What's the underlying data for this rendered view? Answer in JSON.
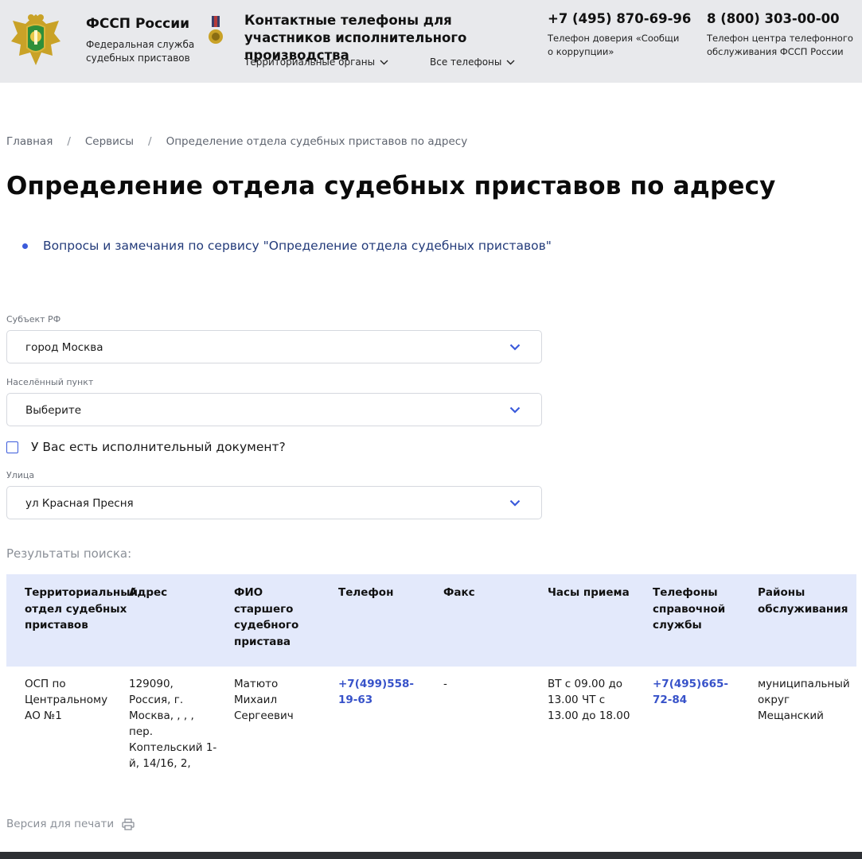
{
  "header": {
    "org_name": "ФССП России",
    "org_subtitle": "Федеральная служба судебных приставов",
    "contacts_title": "Контактные телефоны для участников исполнительного производства",
    "territorial_label": "Территориальные органы",
    "all_phones_label": "Все телефоны",
    "hotline_phone": "+7 (495) 870-69-96",
    "hotline_desc": "Телефон доверия «Сообщи о коррупции»",
    "call_center_phone": "8 (800) 303-00-00",
    "call_center_desc": "Телефон центра телефонного обслуживания ФССП России"
  },
  "breadcrumb": {
    "home": "Главная",
    "services": "Сервисы",
    "current": "Определение отдела судебных приставов по адресу"
  },
  "page_title": "Определение отдела судебных приставов по адресу",
  "feedback_link": "Вопросы и замечания по сервису \"Определение отдела судебных приставов\"",
  "form": {
    "subject_label": "Субъект РФ",
    "subject_value": "город Москва",
    "locality_label": "Населённый пункт",
    "locality_value": "Выберите",
    "has_document_label": "У Вас есть исполнительный документ?",
    "street_label": "Улица",
    "street_value": "ул Красная Пресня"
  },
  "results_label": "Результаты поиска:",
  "table": {
    "headers": {
      "dept": "Территориальный отдел судебных приставов",
      "address": "Адрес",
      "chief": "ФИО старшего судебного пристава",
      "phone": "Телефон",
      "fax": "Факс",
      "hours": "Часы приема",
      "help_phone": "Телефоны справочной службы",
      "districts": "Районы обслуживания"
    },
    "rows": [
      {
        "dept": "ОСП по Центральному АО №1",
        "address": "129090, Россия, г. Москва, , , , пер. Коптельский 1-й, 14/16, 2,",
        "chief": "Матюто Михаил Сергеевич",
        "phone": "+7(499)558-19-63",
        "fax": "-",
        "hours": "ВТ с 09.00 до 13.00 ЧТ с 13.00 до 18.00",
        "help_phone": "+7(495)665-72-84",
        "districts": "муниципальный округ Мещанский"
      }
    ]
  },
  "print_label": "Версия для печати",
  "colors": {
    "header_bg": "#e8e9ec",
    "accent": "#3b5bdb",
    "table_head_bg": "#e3e9fb",
    "link": "#3752c9"
  },
  "icons": [
    "emblem-icon",
    "medal-icon",
    "chevron-down-icon",
    "print-icon"
  ]
}
